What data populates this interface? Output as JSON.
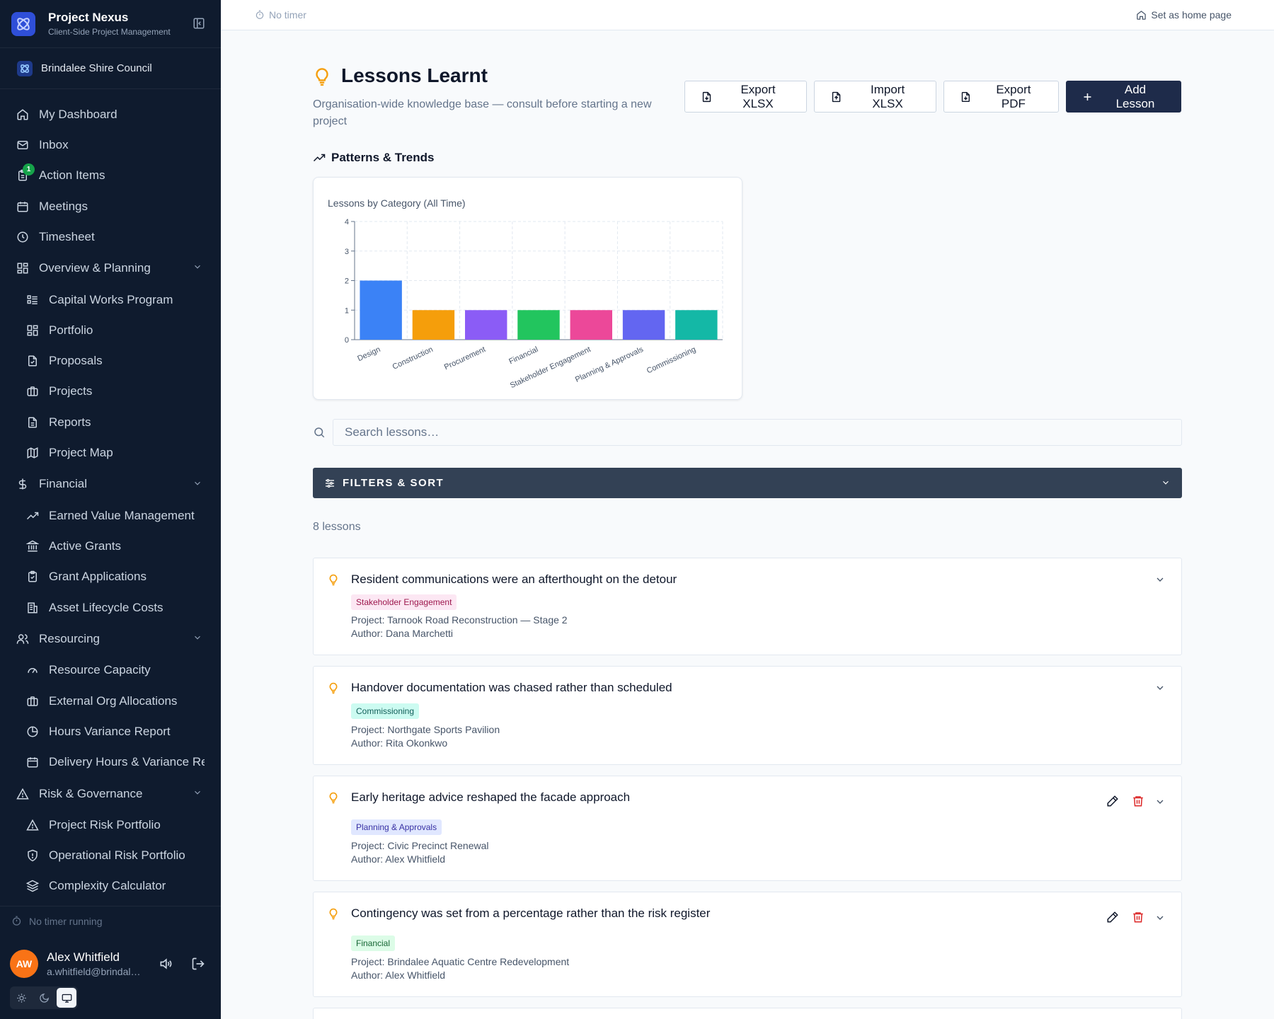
{
  "app": {
    "title": "Project Nexus",
    "subtitle": "Client-Side Project Management",
    "org": "Brindalee Shire Council"
  },
  "sidebar": {
    "items": [
      {
        "label": "My Dashboard",
        "icon": "home-icon"
      },
      {
        "label": "Inbox",
        "icon": "mail-icon"
      },
      {
        "label": "Action Items",
        "icon": "clipboard-icon",
        "badge": "1"
      },
      {
        "label": "Meetings",
        "icon": "calendar-icon"
      },
      {
        "label": "Timesheet",
        "icon": "clock-icon"
      },
      {
        "label": "Overview & Planning",
        "icon": "grid-icon",
        "group": true
      },
      {
        "label": "Capital Works Program",
        "icon": "list-icon"
      },
      {
        "label": "Portfolio",
        "icon": "grid-icon"
      },
      {
        "label": "Proposals",
        "icon": "file-check-icon"
      },
      {
        "label": "Projects",
        "icon": "briefcase-icon"
      },
      {
        "label": "Reports",
        "icon": "file-text-icon"
      },
      {
        "label": "Project Map",
        "icon": "map-icon"
      },
      {
        "label": "Financial",
        "icon": "dollar-icon",
        "group": true
      },
      {
        "label": "Earned Value Management",
        "icon": "trending-up-icon"
      },
      {
        "label": "Active Grants",
        "icon": "bank-icon"
      },
      {
        "label": "Grant Applications",
        "icon": "clipboard-check-icon"
      },
      {
        "label": "Asset Lifecycle Costs",
        "icon": "building-icon"
      },
      {
        "label": "Resourcing",
        "icon": "users-icon",
        "group": true
      },
      {
        "label": "Resource Capacity",
        "icon": "gauge-icon"
      },
      {
        "label": "External Org Allocations",
        "icon": "briefcase-icon"
      },
      {
        "label": "Hours Variance Report",
        "icon": "pie-icon"
      },
      {
        "label": "Delivery Hours & Variance Re",
        "icon": "calendar-icon"
      },
      {
        "label": "Risk & Governance",
        "icon": "alert-icon",
        "group": true
      },
      {
        "label": "Project Risk Portfolio",
        "icon": "alert-icon"
      },
      {
        "label": "Operational Risk Portfolio",
        "icon": "shield-icon"
      },
      {
        "label": "Complexity Calculator",
        "icon": "layers-icon"
      }
    ],
    "timer": "No timer running",
    "user": {
      "initials": "AW",
      "name": "Alex Whitfield",
      "email": "a.whitfield@brindal…"
    }
  },
  "topbar": {
    "timer": "No timer",
    "home": "Set as home page"
  },
  "page": {
    "title": "Lessons Learnt",
    "subtitle": "Organisation-wide knowledge base — consult before starting a new project",
    "actions": {
      "export_xlsx": "Export XLSX",
      "import_xlsx": "Import XLSX",
      "export_pdf": "Export PDF",
      "add": "Add Lesson"
    },
    "section": "Patterns & Trends",
    "search_placeholder": "Search lessons…",
    "filters": "FILTERS & SORT",
    "count": "8 lessons"
  },
  "chart_data": {
    "type": "bar",
    "title": "Lessons by Category (All Time)",
    "categories": [
      "Design",
      "Construction",
      "Procurement",
      "Financial",
      "Stakeholder Engagement",
      "Planning & Approvals",
      "Commissioning"
    ],
    "values": [
      2,
      1,
      1,
      1,
      1,
      1,
      1
    ],
    "colors": [
      "#3b82f6",
      "#f59e0b",
      "#8b5cf6",
      "#22c55e",
      "#ec4899",
      "#6366f1",
      "#14b8a6"
    ],
    "ylim": [
      0,
      4
    ],
    "yticks": [
      0,
      1,
      2,
      3,
      4
    ],
    "grid": true
  },
  "lessons": [
    {
      "title": "Resident communications were an afterthought on the detour",
      "tag": "Stakeholder Engagement",
      "project": "Project: Tarnook Road Reconstruction — Stage 2",
      "author": "Author: Dana Marchetti"
    },
    {
      "title": "Handover documentation was chased rather than scheduled",
      "tag": "Commissioning",
      "project": "Project: Northgate Sports Pavilion",
      "author": "Author: Rita Okonkwo"
    },
    {
      "title": "Early heritage advice reshaped the facade approach",
      "tag": "Planning & Approvals",
      "project": "Project: Civic Precinct Renewal",
      "author": "Author: Alex Whitfield"
    },
    {
      "title": "Contingency was set from a percentage rather than the risk register",
      "tag": "Financial",
      "project": "Project: Brindalee Aquatic Centre Redevelopment",
      "author": "Author: Alex Whitfield"
    }
  ]
}
